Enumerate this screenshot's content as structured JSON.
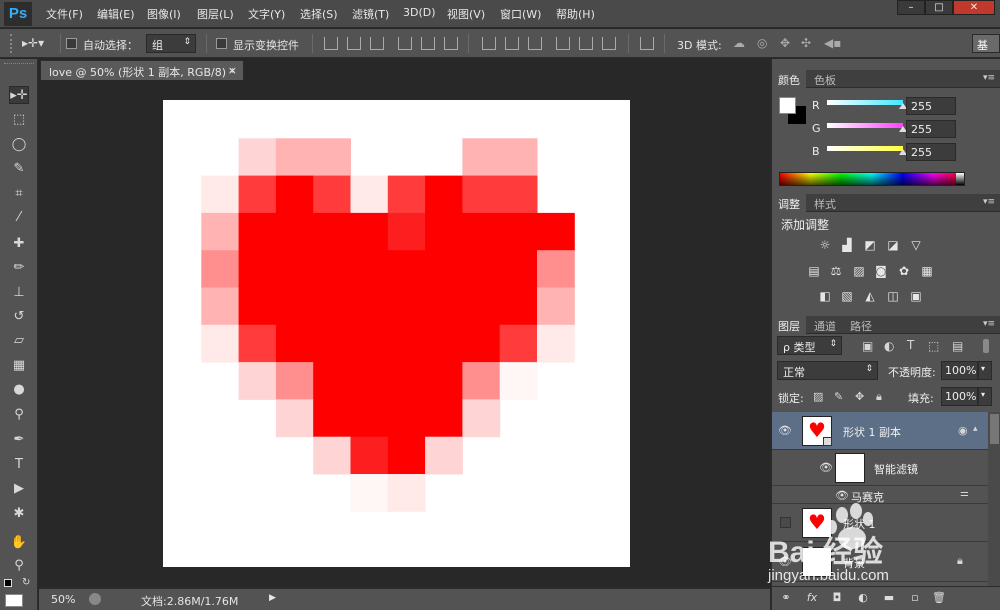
{
  "app": {
    "logo": "Ps"
  },
  "menu": [
    "文件(F)",
    "编辑(E)",
    "图像(I)",
    "图层(L)",
    "文字(Y)",
    "选择(S)",
    "滤镜(T)",
    "3D(D)",
    "视图(V)",
    "窗口(W)",
    "帮助(H)"
  ],
  "window_controls": {
    "minimize": "–",
    "maximize": "□",
    "close": "✕"
  },
  "options": {
    "auto_select_label": "自动选择：",
    "auto_select_value": "组",
    "show_transform_label": "显示变换控件",
    "mode3d_label": "3D 模式:",
    "workspace": "基"
  },
  "document": {
    "tab_title": "love @ 50% (形状 1 副本, RGB/8) *",
    "close": "×"
  },
  "status": {
    "zoom": "50%",
    "doc_info": "文档:2.86M/1.76M",
    "arrow": "▶"
  },
  "color_panel": {
    "tabs": [
      "颜色",
      "色板"
    ],
    "channels": [
      {
        "label": "R",
        "value": "255",
        "color": "#3ee8ff"
      },
      {
        "label": "G",
        "value": "255",
        "color": "#ff40ff"
      },
      {
        "label": "B",
        "value": "255",
        "color": "#ffff40"
      }
    ]
  },
  "adjustments_panel": {
    "tabs": [
      "调整",
      "样式"
    ],
    "title": "添加调整"
  },
  "layers_panel": {
    "tabs": [
      "图层",
      "通道",
      "路径"
    ],
    "filter_label": "ρ 类型",
    "blend_mode": "正常",
    "opacity_label": "不透明度:",
    "opacity_value": "100%",
    "lock_label": "锁定:",
    "fill_label": "填充:",
    "fill_value": "100%",
    "layers": [
      {
        "name": "形状 1 副本",
        "selected": true,
        "visible": true
      },
      {
        "name": "智能滤镜",
        "visible": true
      },
      {
        "name": "马赛克",
        "visible": true
      },
      {
        "name": "形状 1",
        "visible": false
      },
      {
        "name": "背景",
        "visible": true
      }
    ]
  },
  "footer_icons": [
    "link-icon",
    "fx-icon",
    "mask-icon",
    "adjustment-icon",
    "group-icon",
    "new-layer-icon",
    "trash-icon"
  ],
  "watermark": {
    "brand": "Bai 经验",
    "url": "jingyan.baidu.com"
  },
  "heart_colors": {
    "K": "#ff0000",
    "k": "#fd1f1f",
    "d": "#ff3b3b",
    "m": "#ff8f8f",
    "q": "#ffb3b3",
    "w": "#ffd4d4",
    "v": "#ffe9e9",
    "x": "#fff6f6"
  },
  "heart_grid": [
    "............",
    "..wqq...qq..",
    ".vdKdvdKdd..",
    ".qKKKKkKKKK.",
    ".mKKKKKKKKm.",
    ".qKKKKKKKKq.",
    ".vdKKKKKKdv.",
    "..wmKKKKmx..",
    "...wKKKKw...",
    "....wkKw....",
    ".....xv.....",
    "............"
  ]
}
